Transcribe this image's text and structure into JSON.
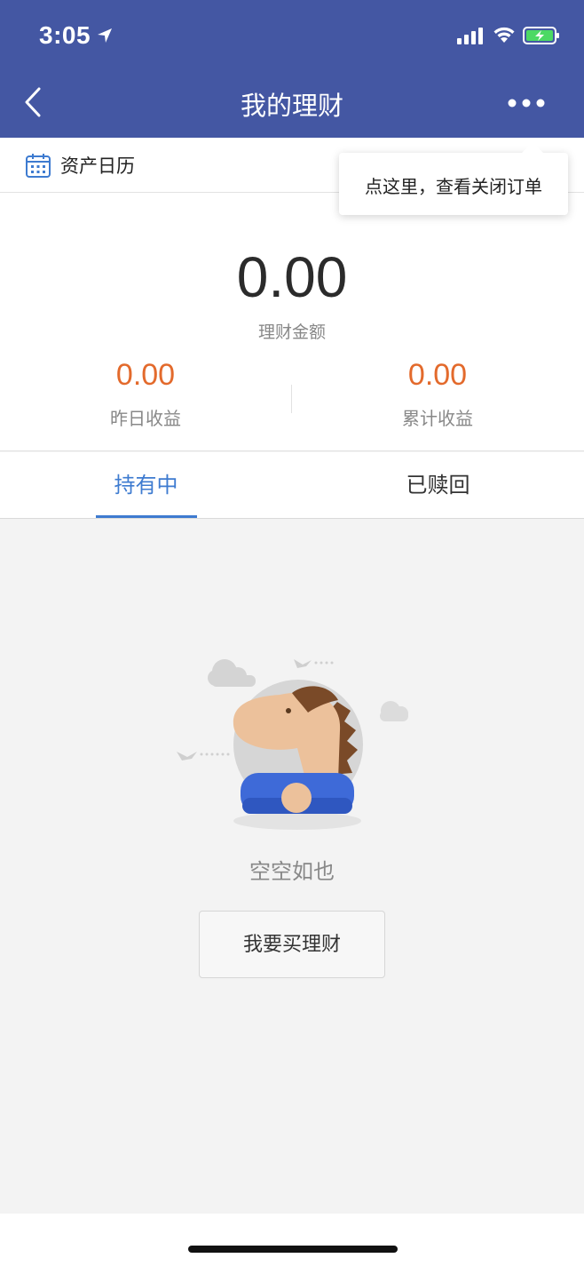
{
  "status_bar": {
    "time": "3:05",
    "icons": [
      "location-arrow-icon",
      "signal-icon",
      "wifi-icon",
      "battery-charging-icon"
    ],
    "battery_color": "#4cd964"
  },
  "header": {
    "title": "我的理财",
    "back_icon": "chevron-left-icon",
    "more_icon": "more-dots-icon",
    "background": "#4457a3"
  },
  "calendar": {
    "icon": "calendar-icon",
    "label": "资产日历"
  },
  "tooltip": {
    "text": "点这里，查看关闭订单"
  },
  "summary": {
    "total_amount": "0.00",
    "total_label": "理财金额",
    "yesterday_value": "0.00",
    "yesterday_label": "昨日收益",
    "cumulative_value": "0.00",
    "cumulative_label": "累计收益",
    "accent_color": "#e36a2c"
  },
  "tabs": {
    "items": [
      {
        "label": "持有中",
        "active": true
      },
      {
        "label": "已赎回",
        "active": false
      }
    ],
    "active_color": "#3e7bd0"
  },
  "empty_state": {
    "illustration": "empty-character-illustration",
    "text": "空空如也",
    "button_label": "我要买理财"
  }
}
